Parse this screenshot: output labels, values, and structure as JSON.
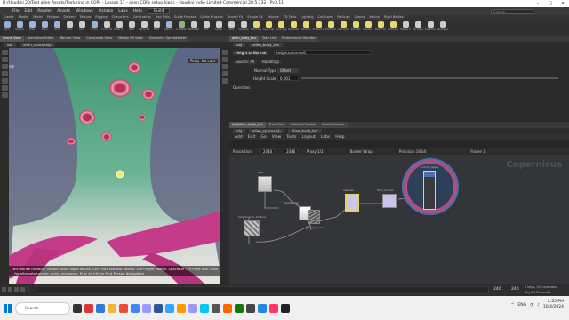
{
  "window": {
    "title": "D:/Houdini 20/Test alien Assets/Texturing in COPs - Lesson 11 - alien COPs setup.hipnc - Houdini Indie Limited-Commercial 20.5.332 - Py3.11"
  },
  "menubar": {
    "items": [
      "File",
      "Edit",
      "Render",
      "Assets",
      "Windows",
      "Octane",
      "Labs",
      "Help"
    ],
    "build": "Build",
    "search_placeholder": "Search"
  },
  "shelf": {
    "tabs": [
      "Create",
      "Modify",
      "Model",
      "Polygon",
      "Deform",
      "Texture",
      "Rigging",
      "Characters",
      "Constraints",
      "Hair Utils",
      "Guide Process",
      "Guide Brushes",
      "Terrain FX",
      "Simple FX",
      "Volume",
      "TD Tools",
      "Lighting",
      "Collisions",
      "Particles",
      "Grains",
      "Vellum",
      "Rigid Bodies",
      "Particle Fluids",
      "Viscous Fluids",
      "Oceans",
      "Pyro FX",
      "FEM",
      "Wires",
      "Crowds",
      "Drive Simulation"
    ],
    "icons": [
      {
        "label": "Box",
        "color": "#8fb0d8"
      },
      {
        "label": "Sphere",
        "color": "#9ab5da"
      },
      {
        "label": "Tube",
        "color": "#9ab5da"
      },
      {
        "label": "Torus",
        "color": "#9ab5da"
      },
      {
        "label": "Grid",
        "color": "#9ab5da"
      },
      {
        "label": "Null",
        "color": "#cccccc"
      },
      {
        "label": "Line",
        "color": "#cccccc"
      },
      {
        "label": "Circle",
        "color": "#9ab5da"
      },
      {
        "label": "Curve Bezier",
        "color": "#cccccc"
      },
      {
        "label": "Draw Curve",
        "color": "#cccccc"
      },
      {
        "label": "Path",
        "color": "#cccccc"
      },
      {
        "label": "Spray Paint",
        "color": "#cccccc"
      },
      {
        "label": "Font",
        "color": "#cccccc"
      },
      {
        "label": "Platonic Solids",
        "color": "#9ab5da"
      },
      {
        "label": "L-System",
        "color": "#88bb77"
      },
      {
        "label": "Metaball",
        "color": "#cccccc"
      },
      {
        "label": "File",
        "color": "#cccccc"
      },
      {
        "label": "Spiral",
        "color": "#cccccc"
      },
      {
        "label": "Helix",
        "color": "#cccccc"
      },
      {
        "label": "Camera",
        "color": "#cccccc"
      },
      {
        "label": "Point Light",
        "color": "#e8d870"
      },
      {
        "label": "Spot Light",
        "color": "#e8d870"
      },
      {
        "label": "Area Light",
        "color": "#e8d870"
      },
      {
        "label": "Geometry Light",
        "color": "#e8d870"
      },
      {
        "label": "Volume Light",
        "color": "#e8d870"
      },
      {
        "label": "Distant Light",
        "color": "#e8d870"
      },
      {
        "label": "Environment Light",
        "color": "#e8d870"
      },
      {
        "label": "Sky Light",
        "color": "#e8d870"
      },
      {
        "label": "GI Light",
        "color": "#e8d870"
      },
      {
        "label": "Caustic Light",
        "color": "#e8d870"
      },
      {
        "label": "Portal Light",
        "color": "#e8d870"
      },
      {
        "label": "Ambient Light",
        "color": "#e8d870"
      },
      {
        "label": "Stereo Camera",
        "color": "#cccccc"
      },
      {
        "label": "VR Camera",
        "color": "#cccccc"
      },
      {
        "label": "Switcher",
        "color": "#cccccc"
      },
      {
        "label": "Gamepad Camera",
        "color": "#cccccc"
      }
    ]
  },
  "left": {
    "tabs": [
      "Scene View",
      "Animation Editor",
      "Render View",
      "Composite View",
      "Motion FX View",
      "Geometry Spreadsheet"
    ],
    "path": [
      "obj",
      "alien_spaceship"
    ],
    "view_label": "View",
    "persp": "Persp",
    "cam": "No cam",
    "status": "Left mouse tumbles. Middle pans. Right dollies. Ctrl+Alt+Left box zooms. Ctrl+Right zooms. Spacebar Ctrl+Left tilts. Hold L for alternate tumble, dolly, and zoom. M or Alt+M for First Person Navigation."
  },
  "right": {
    "tabs_top": [
      "alien_body_tex",
      "Take List",
      "Performance Monitor"
    ],
    "path_top": [
      "obj",
      "alien_body_tex"
    ],
    "node_type": "Height to Normal",
    "node_name": "heighttonormal1",
    "sections": [
      "Source: All",
      "Roadmap"
    ],
    "params": [
      {
        "label": "Normal Type",
        "value": "Offset"
      },
      {
        "label": "Height Scale",
        "value": "0.001"
      }
    ],
    "overrides": "Overrides",
    "tabs_net": [
      "/obj/alien_body_tex",
      "Tree View",
      "Material Palette",
      "Asset Browser"
    ],
    "path_net": [
      "obj",
      "alien_spaceship",
      "alien_body_tex"
    ],
    "net_menu": [
      "Add",
      "Edit",
      "Go",
      "View",
      "Tools",
      "Layout",
      "Labs",
      "Help"
    ],
    "net_info": {
      "resolution_label": "Resolution",
      "res_x": "2048",
      "res_y": "2048",
      "proxy": "Proxy 1/2",
      "border": "Border Wrap",
      "precision": "Precision 16 bit",
      "frame": "Frame 1"
    },
    "watermark": "Copernicus",
    "node_labels": [
      "file1",
      "height_file",
      "heightocolor_texture",
      "grunge_mask",
      "sharpen",
      "OUT_normal",
      "normal_apply"
    ]
  },
  "timeline": {
    "start": "1",
    "current": "1",
    "end": "240",
    "end2": "240",
    "keys": "0 keys, 0/0 channels",
    "key_all": "Key All Channels",
    "auto_update": "Auto Update"
  },
  "taskbar": {
    "search_placeholder": "Search",
    "time": "2:35 PM",
    "date": "10/4/2024",
    "lang": "ENG"
  },
  "colors": {
    "selected_node": "#4a6fb0",
    "viewport_bg": "#4a5470",
    "body_green": "#3f8f6a",
    "tentacle_pink": "#c43b8a"
  }
}
